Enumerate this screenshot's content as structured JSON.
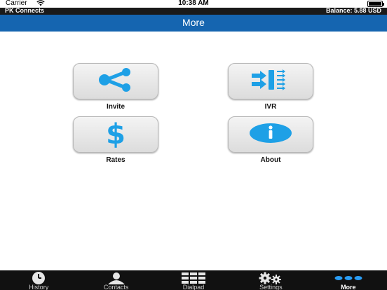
{
  "status_bar": {
    "carrier": "Carrier",
    "time": "10:38 AM",
    "icons": [
      "wifi-icon",
      "battery-icon"
    ]
  },
  "info_bar": {
    "app_name": "PK Connects",
    "balance": "Balance: 5.88 USD"
  },
  "nav": {
    "title": "More"
  },
  "grid": {
    "items": [
      {
        "label": "Invite",
        "icon": "share-icon"
      },
      {
        "label": "IVR",
        "icon": "ivr-icon"
      },
      {
        "label": "Rates",
        "icon": "dollar-icon"
      },
      {
        "label": "About",
        "icon": "info-icon"
      }
    ]
  },
  "tabs": [
    {
      "label": "History",
      "icon": "clock-icon"
    },
    {
      "label": "Contacts",
      "icon": "person-icon"
    },
    {
      "label": "Dialpad",
      "icon": "dialpad-icon"
    },
    {
      "label": "Settings",
      "icon": "gears-icon"
    },
    {
      "label": "More",
      "icon": "ellipsis-icon",
      "active": true
    }
  ],
  "colors": {
    "nav_blue": "#1565b0",
    "icon_blue": "#1ea0e6",
    "tab_active": "#2a9df4",
    "tab_bar": "#111111"
  }
}
